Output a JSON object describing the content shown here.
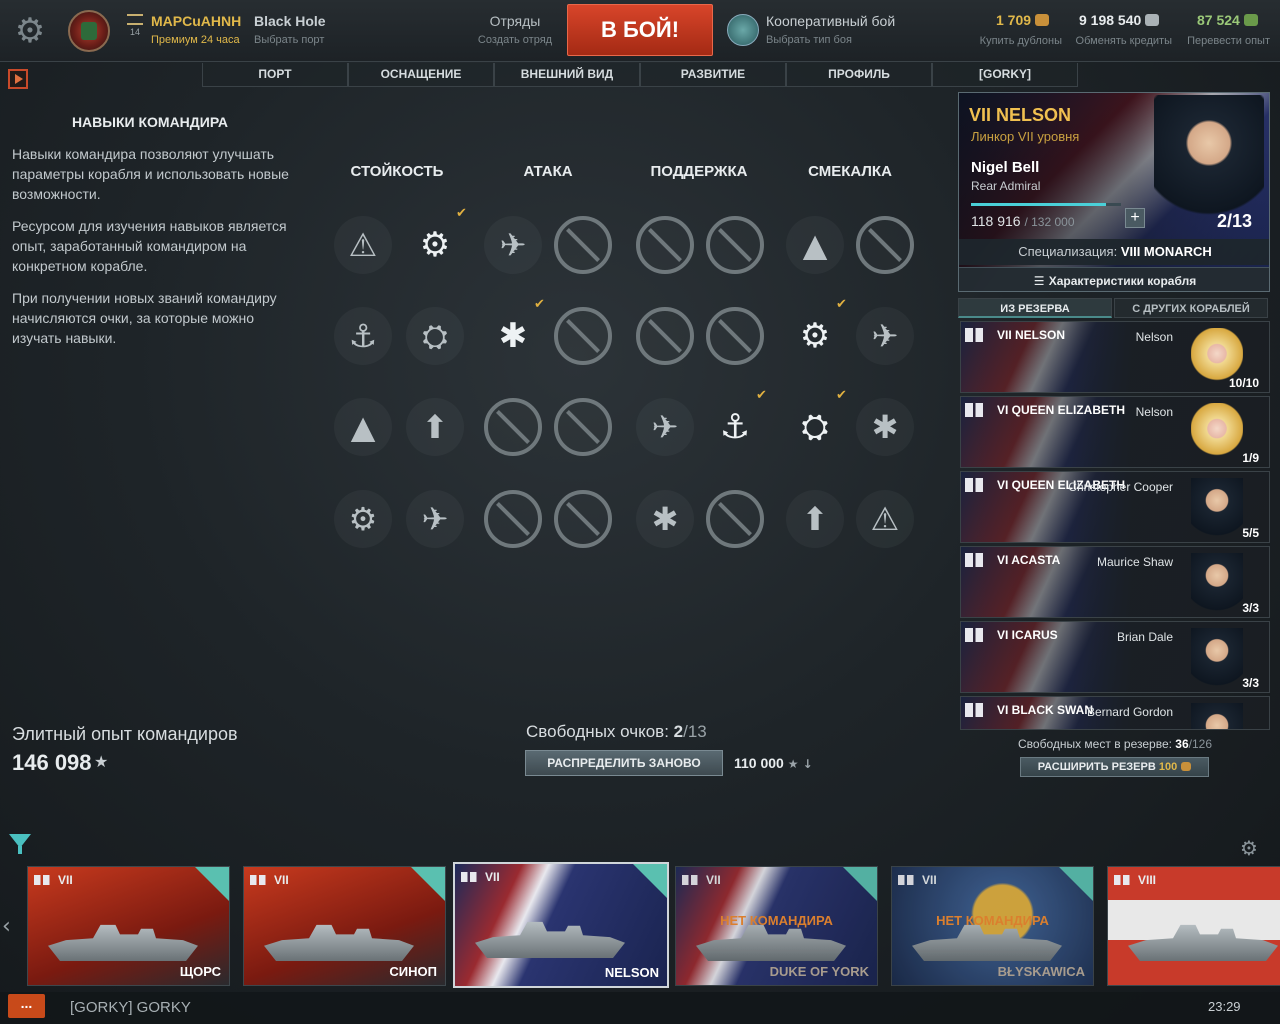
{
  "topbar": {
    "player_name": "MAPCuAHNH",
    "player_level": "14",
    "premium": "Премиум 24 часа",
    "port_name": "Black Hole",
    "port_sub": "Выбрать порт",
    "squad": "Отряды",
    "squad_sub": "Создать отряд",
    "battle": "В БОЙ!",
    "mode": "Кооперативный бой",
    "mode_sub": "Выбрать тип боя",
    "doubloons": "1 709",
    "doubloons_sub": "Купить дублоны",
    "credits": "9 198 540",
    "credits_sub": "Обменять кредиты",
    "xp": "87 524",
    "xp_sub": "Перевести опыт"
  },
  "nav": [
    "ПОРТ",
    "ОСНАЩЕНИЕ",
    "ВНЕШНИЙ ВИД",
    "РАЗВИТИЕ",
    "ПРОФИЛЬ",
    "[GORKY]"
  ],
  "skills_panel": {
    "title": "НАВЫКИ КОМАНДИРА",
    "p1": "Навыки командира позволяют улучшать параметры корабля и использовать новые возможности.",
    "p2": "Ресурсом для изучения навыков является опыт, заработанный командиром на конкретном корабле.",
    "p3": "При получении новых званий командиру начисляются очки, за которые можно изучать навыки.",
    "categories": [
      "СТОЙКОСТЬ",
      "АТАКА",
      "ПОДДЕРЖКА",
      "СМЕКАЛКА"
    ],
    "elite_label": "Элитный опыт командиров",
    "elite_value": "146 098",
    "free_points_label": "Свободных очков:",
    "free_points_value": "2",
    "free_points_total": "/13",
    "redistribute": "РАСПРЕДЕЛИТЬ ЗАНОВО",
    "redistribute_cost": "110 000"
  },
  "commander": {
    "ship": "VII NELSON",
    "ship_sub": "Линкор VII уровня",
    "name": "Nigel Bell",
    "rank": "Rear Admiral",
    "xp_current": "118 916",
    "xp_total": "/ 132 000",
    "xp_fraction": 0.9,
    "points": "2/13",
    "spec_label": "Специализация:",
    "spec_ship": "VIII MONARCH",
    "characteristics": "Характеристики корабля"
  },
  "reserve": {
    "tab_active": "ИЗ РЕЗЕРВА",
    "tab_other": "С ДРУГИХ КОРАБЛЕЙ",
    "items": [
      {
        "ship": "VII NELSON",
        "name": "Nelson",
        "points": "10/10"
      },
      {
        "ship": "VI QUEEN ELIZABETH",
        "name": "Nelson",
        "points": "1/9"
      },
      {
        "ship": "VI QUEEN ELIZABETH",
        "name": "Christopher Cooper",
        "points": "5/5"
      },
      {
        "ship": "VI ACASTA",
        "name": "Maurice Shaw",
        "points": "3/3"
      },
      {
        "ship": "VI ICARUS",
        "name": "Brian Dale",
        "points": "3/3"
      },
      {
        "ship": "VI BLACK SWAN",
        "name": "Bernard Gordon",
        "points": ""
      }
    ],
    "free_slots_label": "Свободных мест в резерве:",
    "free_slots_value": "36",
    "free_slots_total": "/126",
    "expand": "РАСШИРИТЬ РЕЗЕРВ",
    "expand_cost": "100"
  },
  "carousel": [
    {
      "tier": "VII",
      "name": "ЩОРС",
      "nocmd": ""
    },
    {
      "tier": "VII",
      "name": "СИНОП",
      "nocmd": ""
    },
    {
      "tier": "VII",
      "name": "NELSON",
      "nocmd": ""
    },
    {
      "tier": "VII",
      "name": "DUKE OF YORK",
      "nocmd": "НЕТ КОМАНДИРА"
    },
    {
      "tier": "VII",
      "name": "BŁYSKAWICA",
      "nocmd": "НЕТ КОМАНДИРА"
    },
    {
      "tier": "VIII",
      "name": "",
      "nocmd": ""
    }
  ],
  "footer": {
    "chat": "...",
    "clan": "[GORKY] GORKY",
    "time": "23:29"
  },
  "colors": {
    "accent": "#e0b84a",
    "battle": "#c8351e",
    "teal": "#4ac0c0",
    "nocmd": "#f08a30"
  }
}
